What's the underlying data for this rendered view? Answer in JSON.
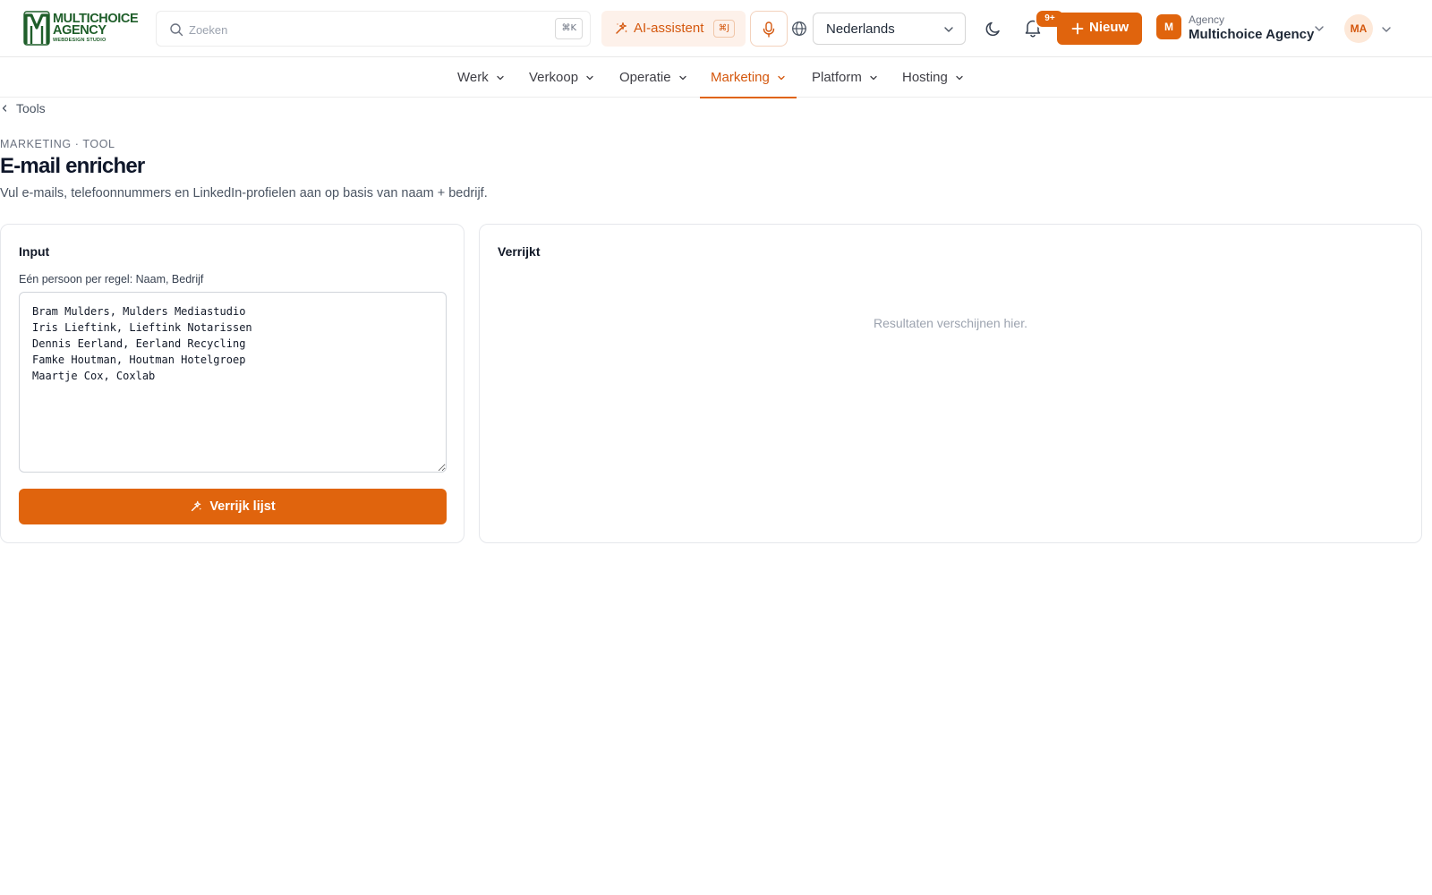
{
  "brand": {
    "line1": "MULTICHOICE",
    "line2": "AGENCY",
    "sub": "WEBDESIGN STUDIO",
    "color": "#1f5e2a"
  },
  "colors": {
    "accent": "#e0640d",
    "accent_soft": "#fdf1ea",
    "text": "#1f2937",
    "muted": "#6b7280"
  },
  "header": {
    "search": {
      "placeholder": "Zoeken",
      "shortcut": "⌘K"
    },
    "ai_button": {
      "label": "AI-assistent",
      "shortcut": "⌘J"
    },
    "language": {
      "selected": "Nederlands"
    },
    "notifications": {
      "badge": "9+"
    },
    "new_button": {
      "label": "Nieuw"
    },
    "agency": {
      "avatar": "M",
      "kind": "Agency",
      "name": "Multichoice Agency"
    },
    "user": {
      "initials": "MA"
    },
    "icons": [
      "search-icon",
      "sparkle-icon",
      "mic-icon",
      "globe-icon",
      "moon-icon",
      "bell-icon",
      "plus-icon",
      "chevron-down-icon"
    ]
  },
  "nav": {
    "items": [
      {
        "label": "Werk",
        "active": false
      },
      {
        "label": "Verkoop",
        "active": false
      },
      {
        "label": "Operatie",
        "active": false
      },
      {
        "label": "Marketing",
        "active": true
      },
      {
        "label": "Platform",
        "active": false
      },
      {
        "label": "Hosting",
        "active": false
      }
    ]
  },
  "breadcrumb": {
    "back_label": "Tools"
  },
  "page": {
    "eyebrow": "MARKETING · TOOL",
    "title": "E-mail enricher",
    "description": "Vul e-mails, telefoonnummers en LinkedIn-profielen aan op basis van naam + bedrijf."
  },
  "input_card": {
    "title": "Input",
    "field_label": "Eén persoon per regel: Naam, Bedrijf",
    "value": "Bram Mulders, Mulders Mediastudio\nIris Lieftink, Lieftink Notarissen\nDennis Eerland, Eerland Recycling\nFamke Houtman, Houtman Hotelgroep\nMaartje Cox, Coxlab",
    "button_label": "Verrijk lijst"
  },
  "output_card": {
    "title": "Verrijkt",
    "empty_text": "Resultaten verschijnen hier."
  }
}
